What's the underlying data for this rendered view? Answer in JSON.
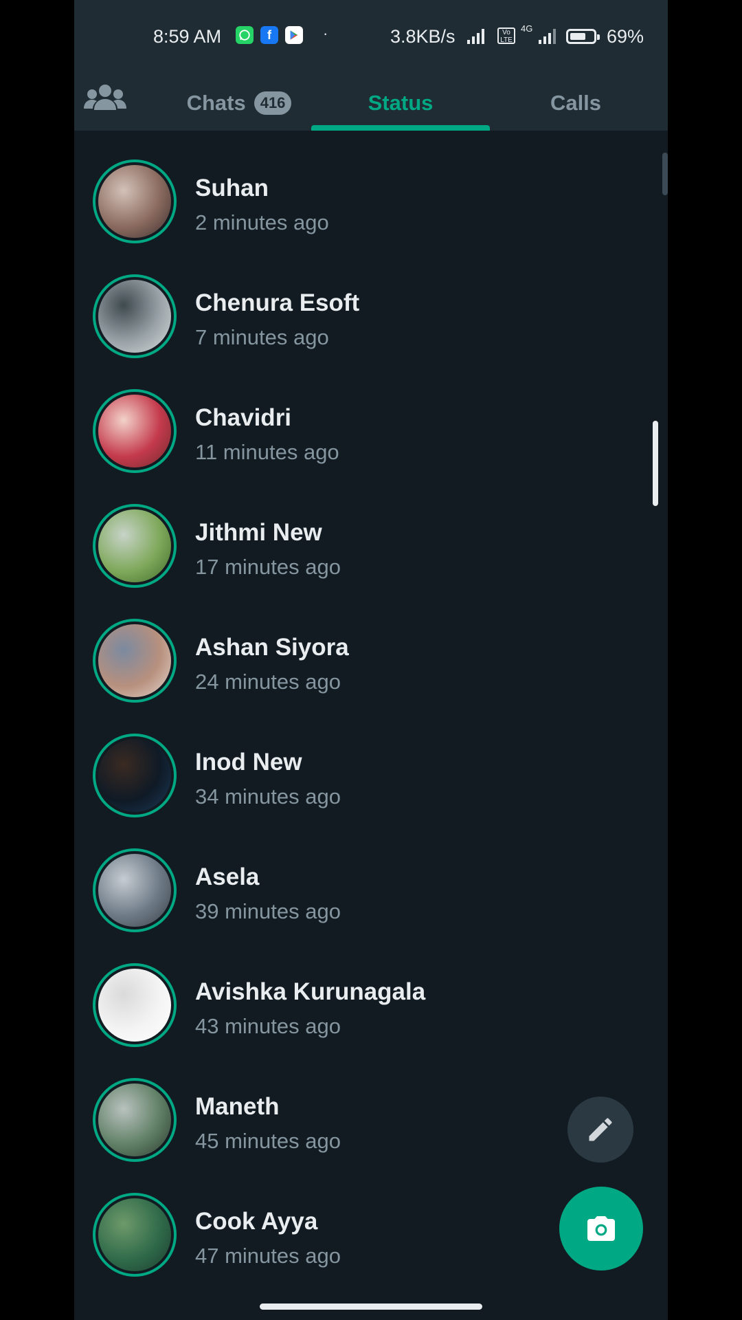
{
  "status_bar": {
    "time": "8:59 AM",
    "net_speed": "3.8KB/s",
    "volte": "Vo LTE",
    "network": "4G",
    "battery_percent": "69%",
    "battery_level": 0.69,
    "notification_icons": [
      "whatsapp-icon",
      "facebook-icon",
      "play-store-icon"
    ]
  },
  "tabs": {
    "chats_label": "Chats",
    "chats_badge": "416",
    "status_label": "Status",
    "calls_label": "Calls",
    "active": "Status"
  },
  "status_updates": [
    {
      "name": "Suhan",
      "time": "2 minutes ago"
    },
    {
      "name": "Chenura Esoft",
      "time": "7 minutes ago"
    },
    {
      "name": "Chavidri",
      "time": "11 minutes ago"
    },
    {
      "name": "Jithmi New",
      "time": "17 minutes ago"
    },
    {
      "name": "Ashan Siyora",
      "time": "24 minutes ago"
    },
    {
      "name": "Inod New",
      "time": "34 minutes ago"
    },
    {
      "name": "Asela",
      "time": "39 minutes ago"
    },
    {
      "name": "Avishka Kurunagala",
      "time": "43 minutes ago"
    },
    {
      "name": "Maneth",
      "time": "45 minutes ago"
    },
    {
      "name": "Cook Ayya",
      "time": "47 minutes ago"
    }
  ],
  "colors": {
    "accent": "#00a884",
    "background": "#111b21",
    "header": "#1f2c34",
    "primary_text": "#e9edef",
    "secondary_text": "#8696a0"
  },
  "fab_icons": {
    "pencil": "pencil-icon",
    "camera": "camera-icon"
  }
}
